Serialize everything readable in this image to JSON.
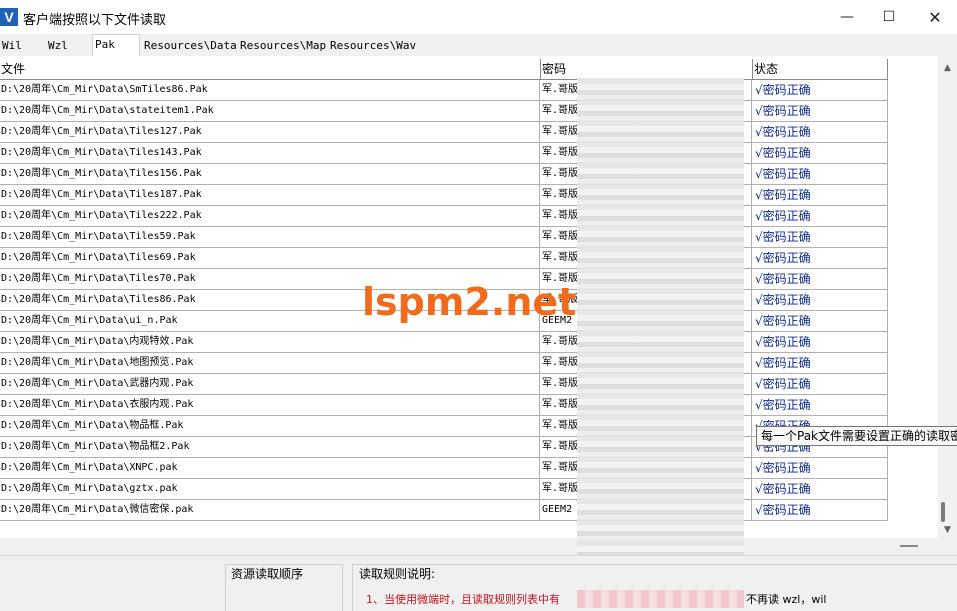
{
  "window": {
    "title": "客户端按照以下文件读取",
    "icon_letter": "V"
  },
  "tabs": [
    "Wil",
    "Wzl",
    "Pak",
    "Resources\\Data",
    "Resources\\Map",
    "Resources\\Wav"
  ],
  "active_tab": "Pak",
  "table": {
    "headers": [
      "文件",
      "密码",
      "状态"
    ],
    "rows": [
      {
        "file": "D:\\20周年\\Cm_Mir\\Data\\SmTiles86.Pak",
        "pwd": "军.哥版",
        "status": "√密码正确"
      },
      {
        "file": "D:\\20周年\\Cm_Mir\\Data\\stateitem1.Pak",
        "pwd": "军.哥版",
        "status": "√密码正确"
      },
      {
        "file": "D:\\20周年\\Cm_Mir\\Data\\Tiles127.Pak",
        "pwd": "军.哥版",
        "status": "√密码正确"
      },
      {
        "file": "D:\\20周年\\Cm_Mir\\Data\\Tiles143.Pak",
        "pwd": "军.哥版",
        "status": "√密码正确"
      },
      {
        "file": "D:\\20周年\\Cm_Mir\\Data\\Tiles156.Pak",
        "pwd": "军.哥版",
        "status": "√密码正确"
      },
      {
        "file": "D:\\20周年\\Cm_Mir\\Data\\Tiles187.Pak",
        "pwd": "军.哥版",
        "status": "√密码正确"
      },
      {
        "file": "D:\\20周年\\Cm_Mir\\Data\\Tiles222.Pak",
        "pwd": "军.哥版",
        "status": "√密码正确"
      },
      {
        "file": "D:\\20周年\\Cm_Mir\\Data\\Tiles59.Pak",
        "pwd": "军.哥版",
        "status": "√密码正确"
      },
      {
        "file": "D:\\20周年\\Cm_Mir\\Data\\Tiles69.Pak",
        "pwd": "军.哥版",
        "status": "√密码正确"
      },
      {
        "file": "D:\\20周年\\Cm_Mir\\Data\\Tiles70.Pak",
        "pwd": "军.哥版",
        "status": "√密码正确"
      },
      {
        "file": "D:\\20周年\\Cm_Mir\\Data\\Tiles86.Pak",
        "pwd": "军.哥版",
        "status": "√密码正确"
      },
      {
        "file": "D:\\20周年\\Cm_Mir\\Data\\ui_n.Pak",
        "pwd": "GEEM2",
        "status": "√密码正确"
      },
      {
        "file": "D:\\20周年\\Cm_Mir\\Data\\内观特效.Pak",
        "pwd": "军.哥版",
        "status": "√密码正确"
      },
      {
        "file": "D:\\20周年\\Cm_Mir\\Data\\地图预览.Pak",
        "pwd": "军.哥版",
        "status": "√密码正确"
      },
      {
        "file": "D:\\20周年\\Cm_Mir\\Data\\武器内观.Pak",
        "pwd": "军.哥版",
        "status": "√密码正确"
      },
      {
        "file": "D:\\20周年\\Cm_Mir\\Data\\衣服内观.Pak",
        "pwd": "军.哥版",
        "status": "√密码正确"
      },
      {
        "file": "D:\\20周年\\Cm_Mir\\Data\\物品框.Pak",
        "pwd": "军.哥版",
        "status": "√密码正确"
      },
      {
        "file": "D:\\20周年\\Cm_Mir\\Data\\物品框2.Pak",
        "pwd": "军.哥版",
        "status": "√密码正确"
      },
      {
        "file": "D:\\20周年\\Cm_Mir\\Data\\XNPC.pak",
        "pwd": "军.哥版",
        "status": "√密码正确"
      },
      {
        "file": "D:\\20周年\\Cm_Mir\\Data\\gztx.pak",
        "pwd": "军.哥版",
        "status": "√密码正确"
      },
      {
        "file": "D:\\20周年\\Cm_Mir\\Data\\微信密保.pak",
        "pwd": "GEEM2",
        "status": "√密码正确"
      }
    ]
  },
  "watermark": "lspm2.net",
  "tooltip": "每一个Pak文件需要设置正确的读取密码",
  "bottom": {
    "left_label": "资源读取顺序",
    "right_label": "读取规则说明:",
    "rule_1_start": "1、当使用微端时，且读取规则列表中有",
    "rule_1_end": "不再读 wzl，wil"
  }
}
